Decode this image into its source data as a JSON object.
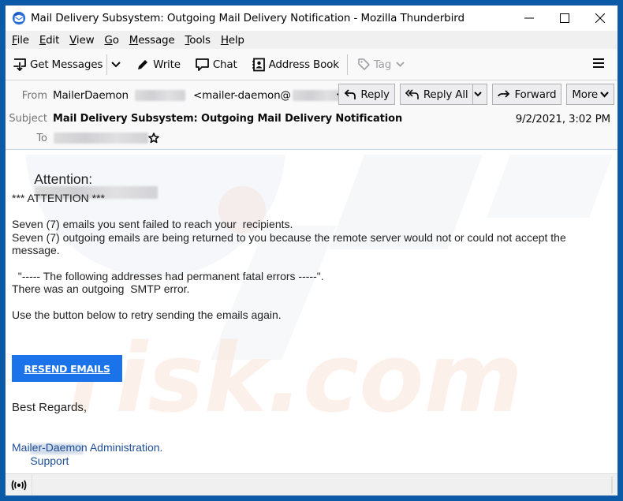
{
  "window": {
    "title": "Mail Delivery Subsystem: Outgoing Mail Delivery Notification - Mozilla Thunderbird",
    "controls": {
      "minimize": "minimize-icon",
      "maximize": "maximize-icon",
      "close": "close-icon"
    }
  },
  "menubar": {
    "items": [
      {
        "accel": "F",
        "rest": "ile"
      },
      {
        "accel": "E",
        "rest": "dit"
      },
      {
        "accel": "V",
        "rest": "iew"
      },
      {
        "accel": "G",
        "rest": "o"
      },
      {
        "accel": "M",
        "rest": "essage"
      },
      {
        "accel": "T",
        "rest": "ools"
      },
      {
        "accel": "H",
        "rest": "elp"
      }
    ]
  },
  "toolbar": {
    "get_messages": "Get Messages",
    "write": "Write",
    "chat": "Chat",
    "address_book": "Address Book",
    "tag": "Tag"
  },
  "header": {
    "labels": {
      "from": "From",
      "subject": "Subject",
      "to": "To"
    },
    "from_name": "MailerDaemon",
    "from_email_prefix": "<mailer-daemon@",
    "from_email_suffix": ">",
    "subject": "Mail Delivery Subsystem: Outgoing Mail Delivery Notification",
    "date": "9/2/2021, 3:02 PM",
    "buttons": {
      "reply": "Reply",
      "reply_all": "Reply All",
      "forward": "Forward",
      "more": "More"
    }
  },
  "body": {
    "attention_label": "Attention:",
    "attention_banner": "*** ATTENTION ***",
    "line1": "Seven (7) emails you sent failed to reach your  recipients.",
    "line2": "Seven (7) outgoing emails are being returned to you because the remote server would not or could not accept the",
    "line3": "message.",
    "line4": "  \"----- The following addresses had permanent fatal errors -----\".",
    "line5": "There was an outgoing  SMTP error.",
    "line6": "Use the button below to retry sending the emails again.",
    "button_label": "RESEND EMAILS",
    "closing": "Best Regards,",
    "signature_line1_suffix": "Support",
    "signature_line2": "Mailer-Daemon Administration.",
    "colors": {
      "button_bg": "#1a73e8",
      "signature": "#1f4e96"
    }
  },
  "statusbar": {
    "icon": "online-status-icon"
  }
}
